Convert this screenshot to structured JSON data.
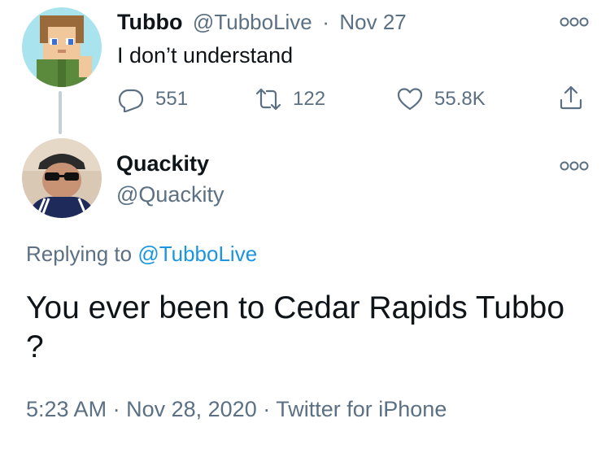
{
  "parent_tweet": {
    "display_name": "Tubbo",
    "handle": "@TubboLive",
    "separator": "·",
    "date": "Nov 27",
    "text": "I don’t understand",
    "replies": "551",
    "retweets": "122",
    "likes": "55.8K"
  },
  "reply_tweet": {
    "display_name": "Quackity",
    "handle": "@Quackity",
    "replying_prefix": "Replying to",
    "replying_handle": "@TubboLive",
    "text": "You ever been to Cedar Rapids Tubbo ?",
    "time": "5:23 AM",
    "sep1": "·",
    "date": "Nov 28, 2020",
    "sep2": "·",
    "source": "Twitter for iPhone"
  },
  "colors": {
    "text": "#0f1419",
    "secondary": "#5b7083",
    "link": "#1b95e0",
    "thread_line": "#c4cfd6"
  },
  "icons": [
    "reply-icon",
    "retweet-icon",
    "like-icon",
    "share-icon",
    "more-icon"
  ]
}
